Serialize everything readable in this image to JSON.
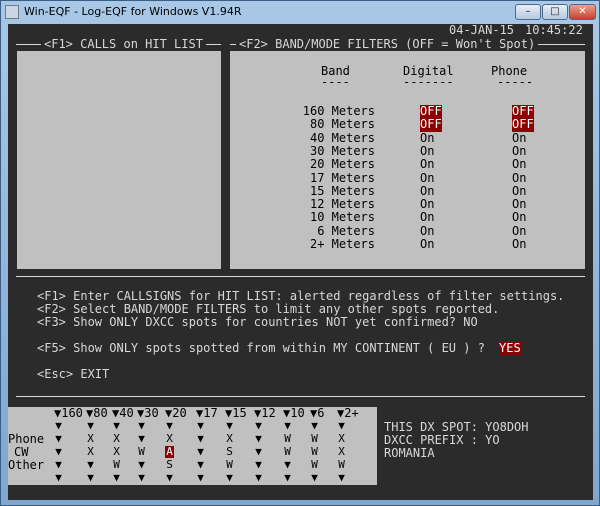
{
  "window": {
    "title": "Win-EQF - Log-EQF for Windows V1.94R",
    "buttons": {
      "minimize": "–",
      "maximize": "□",
      "close": "✕"
    }
  },
  "header": {
    "date": "04-JAN-15",
    "time": "10:45:22"
  },
  "panel_f1": {
    "title": "<F1> CALLS on HIT LIST"
  },
  "panel_f2": {
    "title": "<F2> BAND/MODE FILTERS (OFF = Won't Spot)",
    "col_band": "Band",
    "col_digital": "Digital",
    "col_phone": "Phone",
    "rule_band": "----",
    "rule_digital": "-------",
    "rule_phone": "-----",
    "rows": [
      {
        "band": "160 Meters",
        "digital": "OFF",
        "phone": "OFF"
      },
      {
        "band": "80 Meters",
        "digital": "OFF",
        "phone": "OFF"
      },
      {
        "band": "40 Meters",
        "digital": "On",
        "phone": "On"
      },
      {
        "band": "30 Meters",
        "digital": "On",
        "phone": "On"
      },
      {
        "band": "20 Meters",
        "digital": "On",
        "phone": "On"
      },
      {
        "band": "17 Meters",
        "digital": "On",
        "phone": "On"
      },
      {
        "band": "15 Meters",
        "digital": "On",
        "phone": "On"
      },
      {
        "band": "12 Meters",
        "digital": "On",
        "phone": "On"
      },
      {
        "band": "10 Meters",
        "digital": "On",
        "phone": "On"
      },
      {
        "band": "6 Meters",
        "digital": "On",
        "phone": "On"
      },
      {
        "band": "2+ Meters",
        "digital": "On",
        "phone": "On"
      }
    ]
  },
  "help": {
    "line1": "<F1> Enter CALLSIGNS for HIT LIST: alerted regardless of filter settings.",
    "line2": "<F2> Select BAND/MODE FILTERS to limit any other spots reported.",
    "line3": "<F3> Show ONLY DXCC spots for countries NOT yet confirmed? NO",
    "line5a": "<F5> Show ONLY spots spotted from within MY CONTINENT ( EU ) ?",
    "line5b": "YES",
    "esc": "<Esc> EXIT"
  },
  "band_grid": {
    "bands": [
      "160",
      "80",
      "40",
      "30",
      "20",
      "17",
      "15",
      "12",
      "10",
      "6",
      "2+"
    ],
    "mode_labels": [
      "Phone",
      "CW",
      "Other"
    ],
    "phone": [
      "",
      "X",
      "X",
      "",
      "X",
      "",
      "X",
      "",
      "W",
      "W",
      "X"
    ],
    "cw": [
      "",
      "X",
      "X",
      "W",
      "A",
      "",
      "S",
      "",
      "W",
      "W",
      "X"
    ],
    "other": [
      "",
      "",
      "W",
      "",
      "S",
      "",
      "W",
      "",
      "",
      "W",
      "W"
    ],
    "highlight": "A"
  },
  "spot_info": {
    "line1": "THIS DX SPOT: YO8DOH",
    "line2": "DXCC PREFIX : YO",
    "line3": "ROMANIA"
  }
}
